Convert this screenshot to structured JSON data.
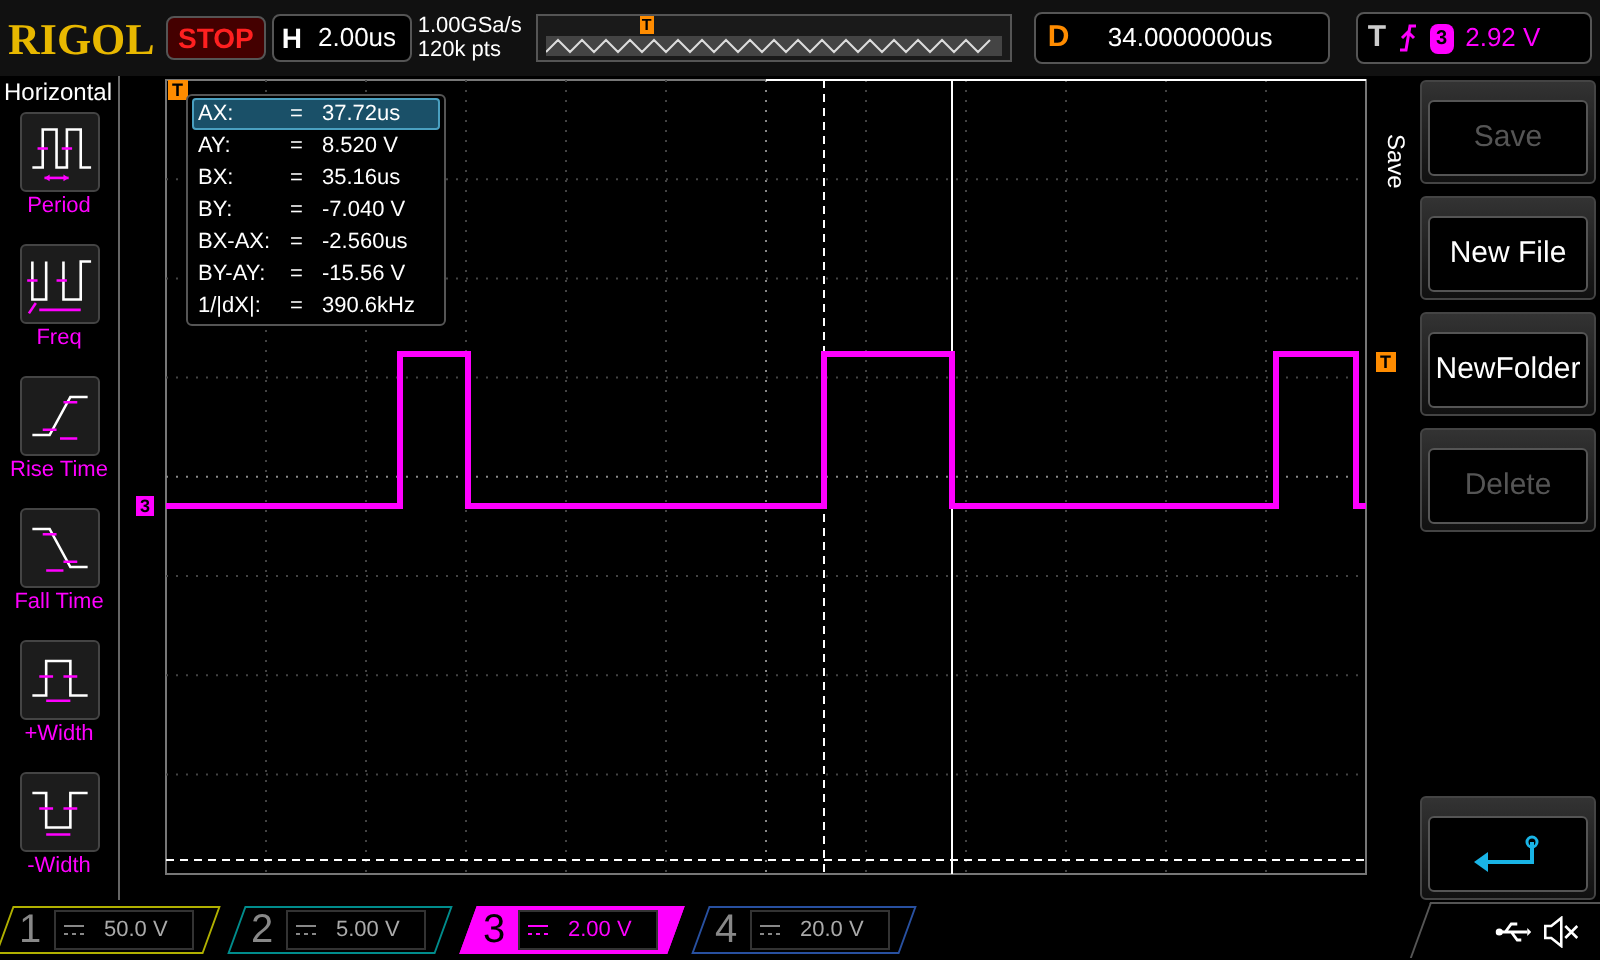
{
  "top_bar": {
    "brand": "RIGOL",
    "run_status": "STOP",
    "timebase": {
      "label": "H",
      "value": "2.00us"
    },
    "sample_rate": "1.00GSa/s",
    "memory_depth": "120k pts",
    "overview_trigger_mark": "T",
    "delay": {
      "label": "D",
      "value": "34.0000000us"
    },
    "trigger": {
      "label": "T",
      "source": "3",
      "level": "2.92 V"
    }
  },
  "left_menu": {
    "title": "Horizontal",
    "items": [
      {
        "kind": "period",
        "label": "Period"
      },
      {
        "kind": "freq",
        "label": "Freq"
      },
      {
        "kind": "rise",
        "label": "Rise Time"
      },
      {
        "kind": "fall",
        "label": "Fall Time"
      },
      {
        "kind": "pwidth",
        "label": "+Width"
      },
      {
        "kind": "nwidth",
        "label": "-Width"
      }
    ]
  },
  "screen": {
    "trigger_position_mark": "T",
    "trigger_level_mark": "T",
    "channel_mark": "3",
    "cursor_readout": [
      {
        "label": "AX:",
        "eq": "=",
        "value": "37.72us",
        "selected": true
      },
      {
        "label": "AY:",
        "eq": "=",
        "value": "8.520 V",
        "selected": false
      },
      {
        "label": "BX:",
        "eq": "=",
        "value": "35.16us",
        "selected": false
      },
      {
        "label": "BY:",
        "eq": "=",
        "value": "-7.040 V",
        "selected": false
      },
      {
        "label": "BX-AX:",
        "eq": "=",
        "value": "-2.560us",
        "selected": false
      },
      {
        "label": "BY-AY:",
        "eq": "=",
        "value": "-15.56 V",
        "selected": false
      },
      {
        "label": "1/|dX|:",
        "eq": "=",
        "value": "390.6kHz",
        "selected": false
      }
    ]
  },
  "right_menu": {
    "title": "Save",
    "buttons": [
      {
        "kind": "text",
        "label": "Save",
        "disabled": true
      },
      {
        "kind": "text",
        "label": "New File",
        "disabled": false
      },
      {
        "kind": "text",
        "label": "NewFolder",
        "disabled": false
      },
      {
        "kind": "text",
        "label": "Delete",
        "disabled": true
      },
      {
        "kind": "back"
      }
    ]
  },
  "channels": [
    {
      "number": "1",
      "scale": "50.0 V",
      "selected": false,
      "color": "#b0b000"
    },
    {
      "number": "2",
      "scale": "5.00 V",
      "selected": false,
      "color": "#008c8c"
    },
    {
      "number": "3",
      "scale": "2.00 V",
      "selected": true,
      "color": "#ff00ff"
    },
    {
      "number": "4",
      "scale": "20.0 V",
      "selected": false,
      "color": "#2850a0"
    }
  ]
}
